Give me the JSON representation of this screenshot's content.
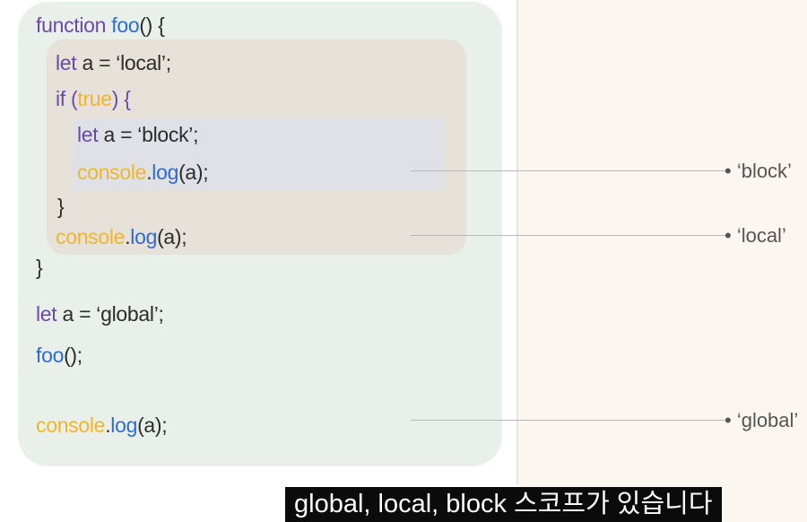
{
  "code": {
    "line1": {
      "kw": "function",
      "name": "foo",
      "rest": "() {"
    },
    "line2": {
      "kw": "let",
      "rest": " a = ‘local’;"
    },
    "line3": {
      "kw": "if (",
      "lit": "true",
      "rest": ") {"
    },
    "line4": {
      "kw": "let",
      "rest": " a = ‘block’;"
    },
    "line5": {
      "obj": "console",
      "dot": ".",
      "method": "log",
      "rest": "(a);"
    },
    "line6": {
      "text": "}"
    },
    "line7": {
      "obj": "console",
      "dot": ".",
      "method": "log",
      "rest": "(a);"
    },
    "line8": {
      "text": "}"
    },
    "line9": {
      "kw": "let",
      "rest": " a = ‘global’;"
    },
    "line10": {
      "name": "foo",
      "rest": "();"
    },
    "line11": {
      "obj": "console",
      "dot": ".",
      "method": "log",
      "rest": "(a);"
    }
  },
  "outputs": {
    "block": "• ‘block’",
    "local": "• ‘local’",
    "global": "• ‘global’"
  },
  "subtitle": "global, local, block 스코프가 있습니다",
  "colors": {
    "keyword": "#6b4aa6",
    "function": "#2f6bd0",
    "console": "#f0b52b",
    "global_scope_bg": "#e9f0ea",
    "local_scope_bg": "#e6e1d9",
    "block_scope_bg": "#dfe1e7"
  }
}
